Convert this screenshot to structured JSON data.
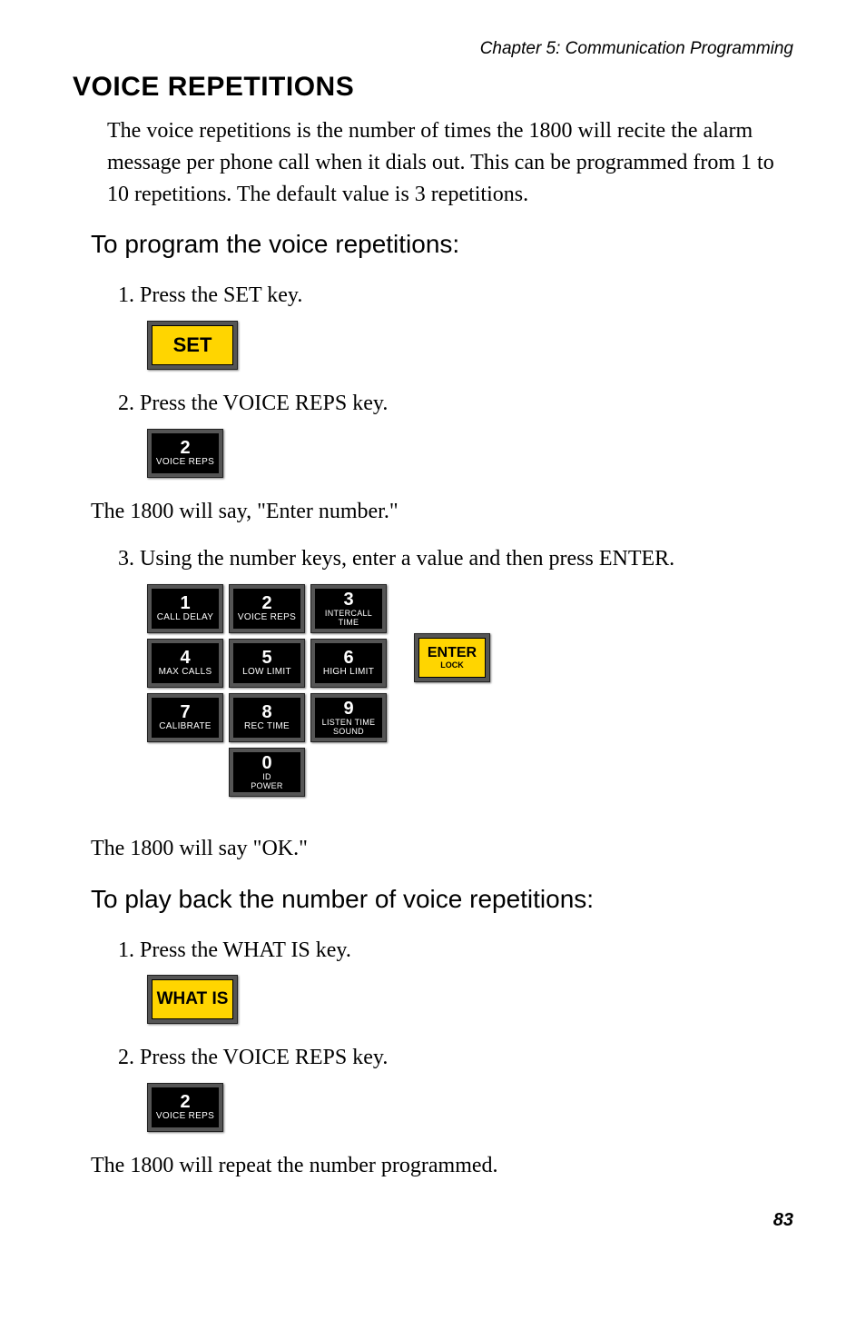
{
  "chapter_header": "Chapter 5: Communication Programming",
  "section_title": "VOICE REPETITIONS",
  "intro": "The voice repetitions is the number of times the 1800 will recite the alarm message per phone call when it dials out. This can be programmed from 1 to 10 repetitions. The default value is 3 repetitions.",
  "subheading1": "To program the voice repetitions:",
  "step1": "1. Press the SET key.",
  "key_set": "SET",
  "step2": "2. Press the VOICE REPS key.",
  "voicereps_num": "2",
  "voicereps_label": "VOICE REPS",
  "after_step2": "The 1800 will say, \"Enter number.\"",
  "step3": "3. Using the number keys, enter a value and then press ENTER.",
  "keypad": {
    "keys": [
      [
        {
          "num": "1",
          "label": "CALL DELAY"
        },
        {
          "num": "2",
          "label": "VOICE REPS"
        },
        {
          "num": "3",
          "label": "INTERCALL TIME",
          "wide": true
        }
      ],
      [
        {
          "num": "4",
          "label": "MAX CALLS"
        },
        {
          "num": "5",
          "label": "LOW LIMIT"
        },
        {
          "num": "6",
          "label": "HIGH LIMIT"
        }
      ],
      [
        {
          "num": "7",
          "label": "CALIBRATE"
        },
        {
          "num": "8",
          "label": "REC TIME"
        },
        {
          "num": "9",
          "label": "LISTEN TIME\nSOUND",
          "wide": true
        }
      ],
      [
        {
          "num": "0",
          "label": "ID\nPOWER",
          "wide": true
        }
      ]
    ],
    "enter_main": "ENTER",
    "enter_sub": "LOCK"
  },
  "after_keypad": "The 1800 will say \"OK.\"",
  "subheading2": "To play back the number of voice repetitions:",
  "pb_step1": "1. Press the WHAT IS key.",
  "key_whatis": "WHAT IS",
  "pb_step2": "2. Press the VOICE REPS key.",
  "after_pb": "The 1800 will repeat the number programmed.",
  "page_number": "83"
}
